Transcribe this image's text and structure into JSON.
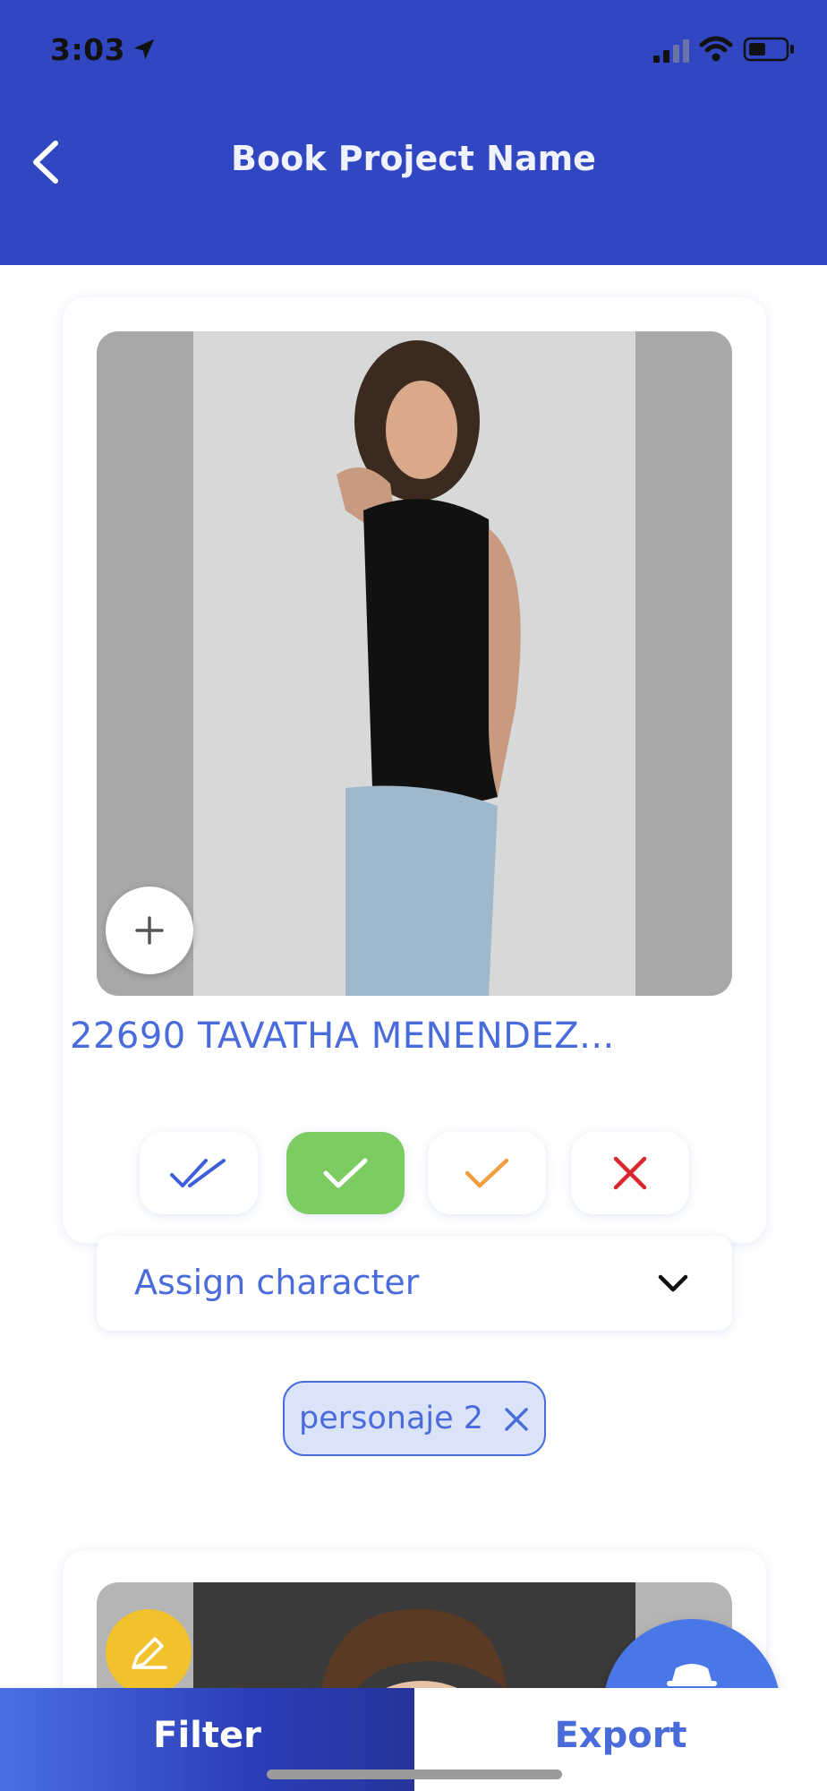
{
  "status_bar": {
    "time": "3:03"
  },
  "header": {
    "title": "Book Project Name"
  },
  "card": {
    "name": "22690 TAVATHA MENENDEZ...",
    "assign_label": "Assign character",
    "chip_label": "personaje 2"
  },
  "bottom_bar": {
    "filter_label": "Filter",
    "export_label": "Export"
  },
  "colors": {
    "header_bg": "#3147c1",
    "accent": "#4a6cdb",
    "approve_green": "#7ccc62",
    "maybe_orange": "#f0a040",
    "reject_red": "#d8282e",
    "fab_blue": "#4a77e8",
    "edit_yellow": "#f2c12e"
  },
  "icons": [
    "location-arrow-icon",
    "signal-icon",
    "wifi-icon",
    "battery-icon",
    "back-chevron-icon",
    "plus-icon",
    "double-check-icon",
    "check-icon",
    "close-icon",
    "chevron-down-icon",
    "add-character-icon",
    "edit-icon"
  ]
}
